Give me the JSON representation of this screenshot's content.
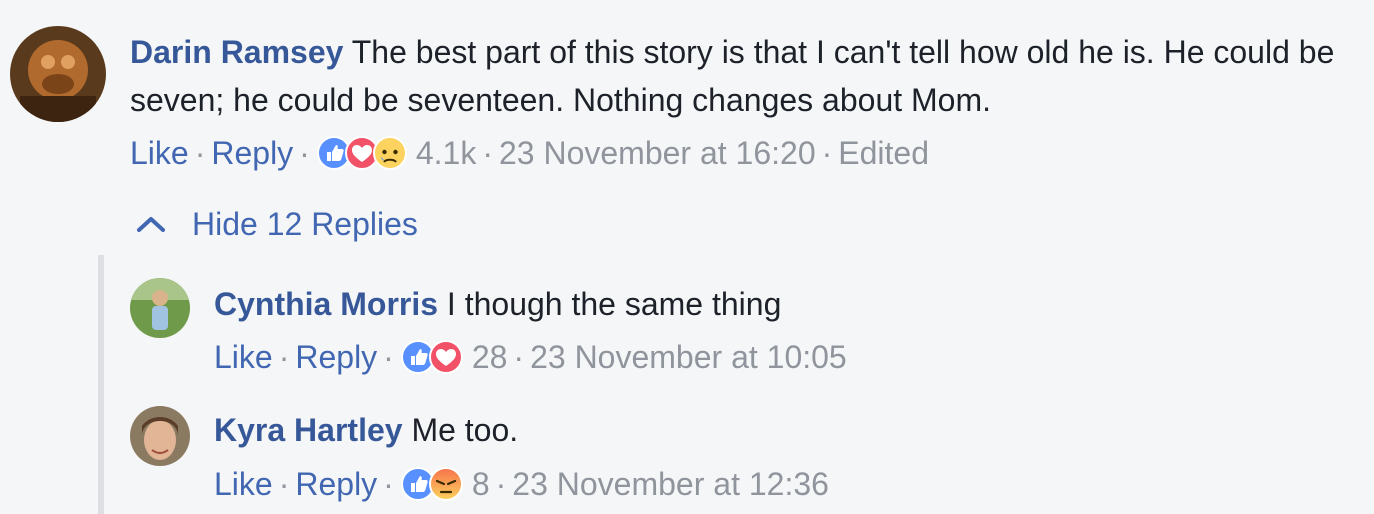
{
  "comments": [
    {
      "author": "Darin Ramsey",
      "text": "The best part of this story is that I can't tell how old he is. He could be seven; he could be seventeen. Nothing changes about Mom.",
      "like_label": "Like",
      "reply_label": "Reply",
      "reactions": [
        "like",
        "love",
        "sad"
      ],
      "reaction_count": "4.1k",
      "timestamp": "23 November at 16:20",
      "edited_label": "Edited"
    }
  ],
  "replies_toggle": {
    "label": "Hide 12 Replies",
    "icon": "chevron-up-icon"
  },
  "replies": [
    {
      "author": "Cynthia Morris",
      "text": "I though the same thing",
      "like_label": "Like",
      "reply_label": "Reply",
      "reactions": [
        "like",
        "love"
      ],
      "reaction_count": "28",
      "timestamp": "23 November at 10:05"
    },
    {
      "author": "Kyra Hartley",
      "text": "Me too.",
      "like_label": "Like",
      "reply_label": "Reply",
      "reactions": [
        "like",
        "angry"
      ],
      "reaction_count": "8",
      "timestamp": "23 November at 12:36"
    }
  ],
  "separator": "·",
  "colors": {
    "link": "#365899",
    "action_link": "#4267b2",
    "meta": "#90949c",
    "like_blue": "#5890ff",
    "love_red": "#f25268",
    "sad_yellow": "#fcd35e",
    "angry_orange": "#f7714b"
  }
}
